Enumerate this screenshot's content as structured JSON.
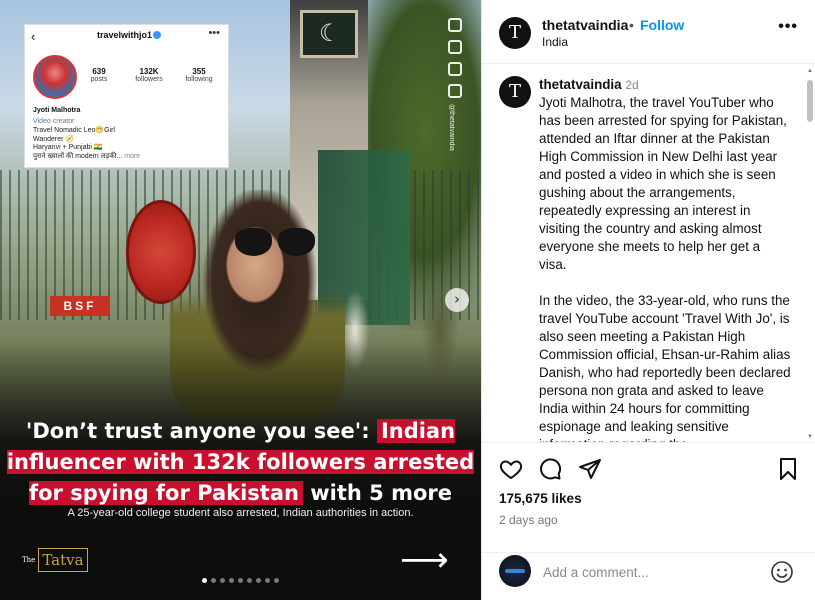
{
  "post": {
    "account": "thetatvaindia",
    "separator": "•",
    "follow_label": "Follow",
    "location": "India",
    "avatar_letter": "T",
    "more_label": "•••"
  },
  "caption": {
    "time_ago": "2d",
    "paragraphs": [
      "Jyoti Malhotra, the travel YouTuber who has been arrested for spying for Pakistan, attended an Iftar dinner at the Pakistan High Commission in New Delhi last year and posted a video in which she is seen gushing about the arrangements, repeatedly expressing an interest in visiting the country and asking almost everyone she meets to help her get a visa.",
      "In the video, the 33-year-old, who runs the travel YouTube account 'Travel With Jo', is also seen meeting a Pakistan High Commission official, Ehsan-ur-Rahim alias Danish, who had reportedly been declared persona non grata and asked to leave India within 24 hours for committing espionage and leaking sensitive information regarding the"
    ]
  },
  "engagement": {
    "likes": "175,675 likes",
    "date": "2 days ago"
  },
  "comment": {
    "placeholder": "Add a comment..."
  },
  "media": {
    "profile_card": {
      "back": "‹",
      "username": "travelwithjo1",
      "menu": "•••",
      "posts": "639",
      "posts_label": "posts",
      "followers": "132K",
      "followers_label": "followers",
      "following": "355",
      "following_label": "following",
      "name": "Jyoti Malhotra",
      "category": "Video creator",
      "bio_line1": "Travel Nomadic Leo😁Girl",
      "bio_line2": "Wanderer 🧭",
      "bio_line3": "Haryanvi + Punjabi 🇮🇳",
      "bio_line4": "पुराने ख्यालों की modern लड़की...",
      "bio_more": "more"
    },
    "vertical_handle": "@thetatvaindia",
    "gate_sign": "BSF",
    "headline_part1": "'Don’t trust anyone you see':",
    "headline_hl1": "Indian influencer with 132k followers arrested for spying for Pakistan",
    "headline_part2": "with 5 more",
    "subheadline": "A 25-year-old college student also arrested, Indian authorities in action.",
    "logo_the": "The",
    "logo_name": "Tatva",
    "next_glyph": "›",
    "arrow_glyph": "⟶",
    "page_count": 9,
    "active_page": 1
  },
  "icons": [
    "heart-icon",
    "comment-icon",
    "share-icon",
    "bookmark-icon",
    "emoji-icon",
    "chevron-right-icon",
    "arrow-right-icon"
  ],
  "colors": {
    "follow_blue": "#0095f6",
    "headline_red": "#c8102e",
    "verified_blue": "#3897f0"
  }
}
